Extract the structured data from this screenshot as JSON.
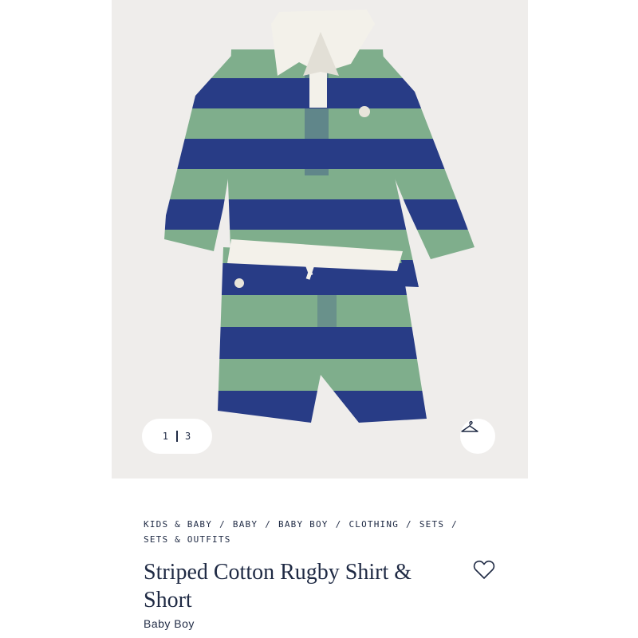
{
  "gallery": {
    "image_alt": "Striped Cotton Rugby Shirt & Short",
    "current_page": "1",
    "total_pages": "3",
    "hanger_icon": "hanger-icon",
    "colors": {
      "green": "#7fae8c",
      "navy": "#283c86",
      "collar": "#f3f1ea",
      "background": "#efedeb"
    }
  },
  "breadcrumb": [
    "KIDS & BABY",
    "BABY",
    "BABY BOY",
    "CLOTHING",
    "SETS",
    "SETS & OUTFITS"
  ],
  "product": {
    "title": "Striped Cotton Rugby Shirt & Short",
    "subtitle": "Baby Boy",
    "wishlist_icon": "heart-icon"
  }
}
